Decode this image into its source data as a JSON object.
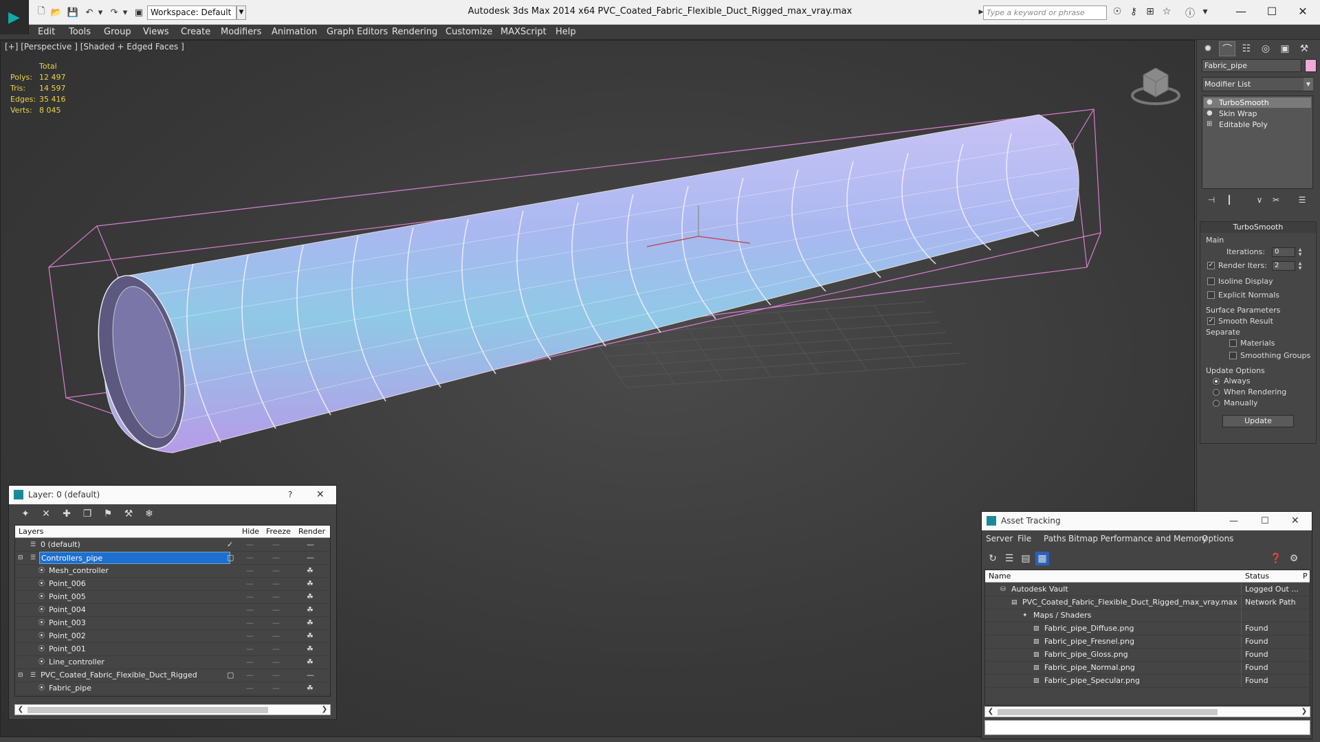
{
  "app": {
    "title": "Autodesk 3ds Max  2014 x64      PVC_Coated_Fabric_Flexible_Duct_Rigged_max_vray.max",
    "workspace": "Workspace: Default",
    "search_placeholder": "Type a keyword or phrase"
  },
  "menu": [
    "Edit",
    "Tools",
    "Group",
    "Views",
    "Create",
    "Modifiers",
    "Animation",
    "Graph Editors",
    "Rendering",
    "Customize",
    "MAXScript",
    "Help"
  ],
  "viewport": {
    "label": "[+] [Perspective ] [Shaded + Edged Faces ]",
    "stats": {
      "header": "Total",
      "rows": [
        {
          "k": "Polys:",
          "v": "12 497"
        },
        {
          "k": "Tris:",
          "v": "14 597"
        },
        {
          "k": "Edges:",
          "v": "35 416"
        },
        {
          "k": "Verts:",
          "v": "8 045"
        }
      ]
    }
  },
  "command_panel": {
    "object_name": "Fabric_pipe",
    "object_color": "#f2a8d8",
    "modifier_list": "Modifier List",
    "stack": [
      "TurboSmooth",
      "Skin Wrap",
      "Editable Poly"
    ],
    "rollout": {
      "title": "TurboSmooth",
      "main": "Main",
      "iterations_label": "Iterations:",
      "iterations_value": "0",
      "render_iters_label": "Render Iters:",
      "render_iters_value": "2",
      "isoline": "Isoline Display",
      "explicit_normals": "Explicit Normals",
      "surface_params": "Surface Parameters",
      "smooth_result": "Smooth Result",
      "separate": "Separate",
      "materials": "Materials",
      "smoothing_groups": "Smoothing Groups",
      "update_options": "Update Options",
      "always": "Always",
      "when_rendering": "When Rendering",
      "manually": "Manually",
      "update_button": "Update"
    }
  },
  "layer_panel": {
    "title": "Layer: 0 (default)",
    "help": "?",
    "columns": [
      "Layers",
      "Hide",
      "Freeze",
      "Render"
    ],
    "rows": [
      {
        "name": "0 (default)",
        "level": 1
      },
      {
        "name": "Controllers_pipe",
        "level": 1
      },
      {
        "name": "Mesh_controller",
        "level": 2
      },
      {
        "name": "Point_006",
        "level": 2
      },
      {
        "name": "Point_005",
        "level": 2
      },
      {
        "name": "Point_004",
        "level": 2
      },
      {
        "name": "Point_003",
        "level": 2
      },
      {
        "name": "Point_002",
        "level": 2
      },
      {
        "name": "Point_001",
        "level": 2
      },
      {
        "name": "Line_controller",
        "level": 2
      },
      {
        "name": "PVC_Coated_Fabric_Flexible_Duct_Rigged",
        "level": 1
      },
      {
        "name": "Fabric_pipe",
        "level": 2
      }
    ]
  },
  "asset_panel": {
    "title": "Asset Tracking",
    "menu": [
      "Server",
      "File",
      "Paths",
      "Bitmap Performance and Memory",
      "Options"
    ],
    "columns": [
      "Name",
      "Status",
      "P"
    ],
    "rows": [
      {
        "name": "Autodesk Vault",
        "status": "Logged Out ...",
        "level": 0
      },
      {
        "name": "PVC_Coated_Fabric_Flexible_Duct_Rigged_max_vray.max",
        "status": "Network Path",
        "level": 1
      },
      {
        "name": "Maps / Shaders",
        "status": "",
        "level": 2
      },
      {
        "name": "Fabric_pipe_Diffuse.png",
        "status": "Found",
        "level": 3
      },
      {
        "name": "Fabric_pipe_Fresnel.png",
        "status": "Found",
        "level": 3
      },
      {
        "name": "Fabric_pipe_Gloss.png",
        "status": "Found",
        "level": 3
      },
      {
        "name": "Fabric_pipe_Normal.png",
        "status": "Found",
        "level": 3
      },
      {
        "name": "Fabric_pipe_Specular.png",
        "status": "Found",
        "level": 3
      }
    ]
  }
}
